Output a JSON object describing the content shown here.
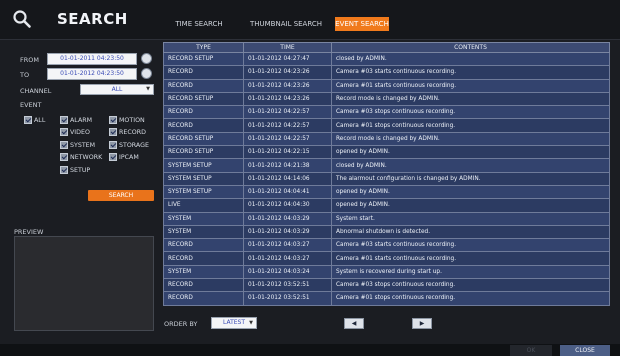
{
  "header": {
    "title": "SEARCH",
    "tabs": [
      {
        "label": "TIME SEARCH",
        "active": false
      },
      {
        "label": "THUMBNAIL SEARCH",
        "active": false
      },
      {
        "label": "EVENT SEARCH",
        "active": true
      }
    ],
    "accent_color": "#f07a1c"
  },
  "filters": {
    "from_label": "FROM",
    "from_value": "01-01-2011 04:23:50",
    "to_label": "TO",
    "to_value": "01-01-2012 04:23:50",
    "channel_label": "CHANNEL",
    "channel_value": "ALL",
    "event_label": "EVENT",
    "events": {
      "all": "ALL",
      "alarm": "ALARM",
      "motion": "MOTION",
      "video": "VIDEO",
      "record": "RECORD",
      "system": "SYSTEM",
      "storage": "STORAGE",
      "network": "NETWORK",
      "ipcam": "IPCAM",
      "setup": "SETUP"
    },
    "search_label": "SEARCH"
  },
  "preview": {
    "label": "PREVIEW"
  },
  "table": {
    "headers": [
      "TYPE",
      "TIME",
      "CONTENTS"
    ],
    "rows": [
      [
        "RECORD SETUP",
        "01-01-2012 04:27:47",
        "closed by ADMIN."
      ],
      [
        "RECORD",
        "01-01-2012 04:23:26",
        "Camera #03 starts continuous recording."
      ],
      [
        "RECORD",
        "01-01-2012 04:23:26",
        "Camera #01 starts continuous recording."
      ],
      [
        "RECORD SETUP",
        "01-01-2012 04:23:26",
        "Record mode is changed by ADMIN."
      ],
      [
        "RECORD",
        "01-01-2012 04:22:57",
        "Camera #03 stops continuous recording."
      ],
      [
        "RECORD",
        "01-01-2012 04:22:57",
        "Camera #01 stops continuous recording."
      ],
      [
        "RECORD SETUP",
        "01-01-2012 04:22:57",
        "Record mode is changed by ADMIN."
      ],
      [
        "RECORD SETUP",
        "01-01-2012 04:22:15",
        "opened by ADMIN."
      ],
      [
        "SYSTEM SETUP",
        "01-01-2012 04:21:38",
        "closed by ADMIN."
      ],
      [
        "SYSTEM SETUP",
        "01-01-2012 04:14:06",
        "The alarmout configuration is changed by ADMIN."
      ],
      [
        "SYSTEM SETUP",
        "01-01-2012 04:04:41",
        "opened by ADMIN."
      ],
      [
        "LIVE",
        "01-01-2012 04:04:30",
        "opened by ADMIN."
      ],
      [
        "SYSTEM",
        "01-01-2012 04:03:29",
        "System start."
      ],
      [
        "SYSTEM",
        "01-01-2012 04:03:29",
        "Abnormal shutdown is detected."
      ],
      [
        "RECORD",
        "01-01-2012 04:03:27",
        "Camera #03 starts continuous recording."
      ],
      [
        "RECORD",
        "01-01-2012 04:03:27",
        "Camera #01 starts continuous recording."
      ],
      [
        "SYSTEM",
        "01-01-2012 04:03:24",
        "System is recovered during start up."
      ],
      [
        "RECORD",
        "01-01-2012 03:52:51",
        "Camera #03 stops continuous recording."
      ],
      [
        "RECORD",
        "01-01-2012 03:52:51",
        "Camera #01 stops continuous recording."
      ]
    ]
  },
  "order": {
    "label": "ORDER BY",
    "value": "LATEST"
  },
  "pager": {
    "prev": "◀",
    "next": "▶"
  },
  "footer": {
    "ok_label": "OK",
    "close_label": "CLOSE"
  }
}
